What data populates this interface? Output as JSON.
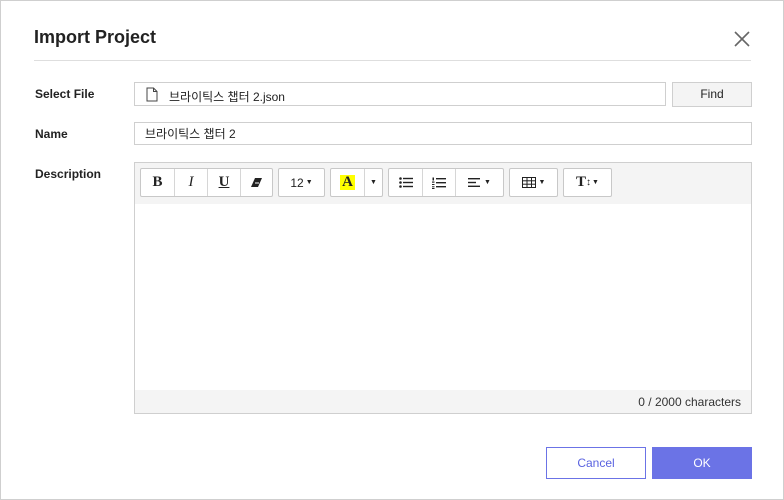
{
  "dialog": {
    "title": "Import Project"
  },
  "select_file": {
    "label": "Select File",
    "file_name": "브라이틱스 챕터 2.json",
    "find_label": "Find"
  },
  "name": {
    "label": "Name",
    "value": "브라이틱스 챕터 2"
  },
  "description": {
    "label": "Description",
    "toolbar": {
      "bold": "B",
      "italic": "I",
      "underline": "U",
      "font_size": "12",
      "highlight": "A",
      "text_style": "T"
    },
    "content": "",
    "counter": "0 / 2000 characters"
  },
  "footer": {
    "cancel_label": "Cancel",
    "ok_label": "OK"
  },
  "colors": {
    "accent": "#6b73e6",
    "highlight": "#ffff00"
  }
}
